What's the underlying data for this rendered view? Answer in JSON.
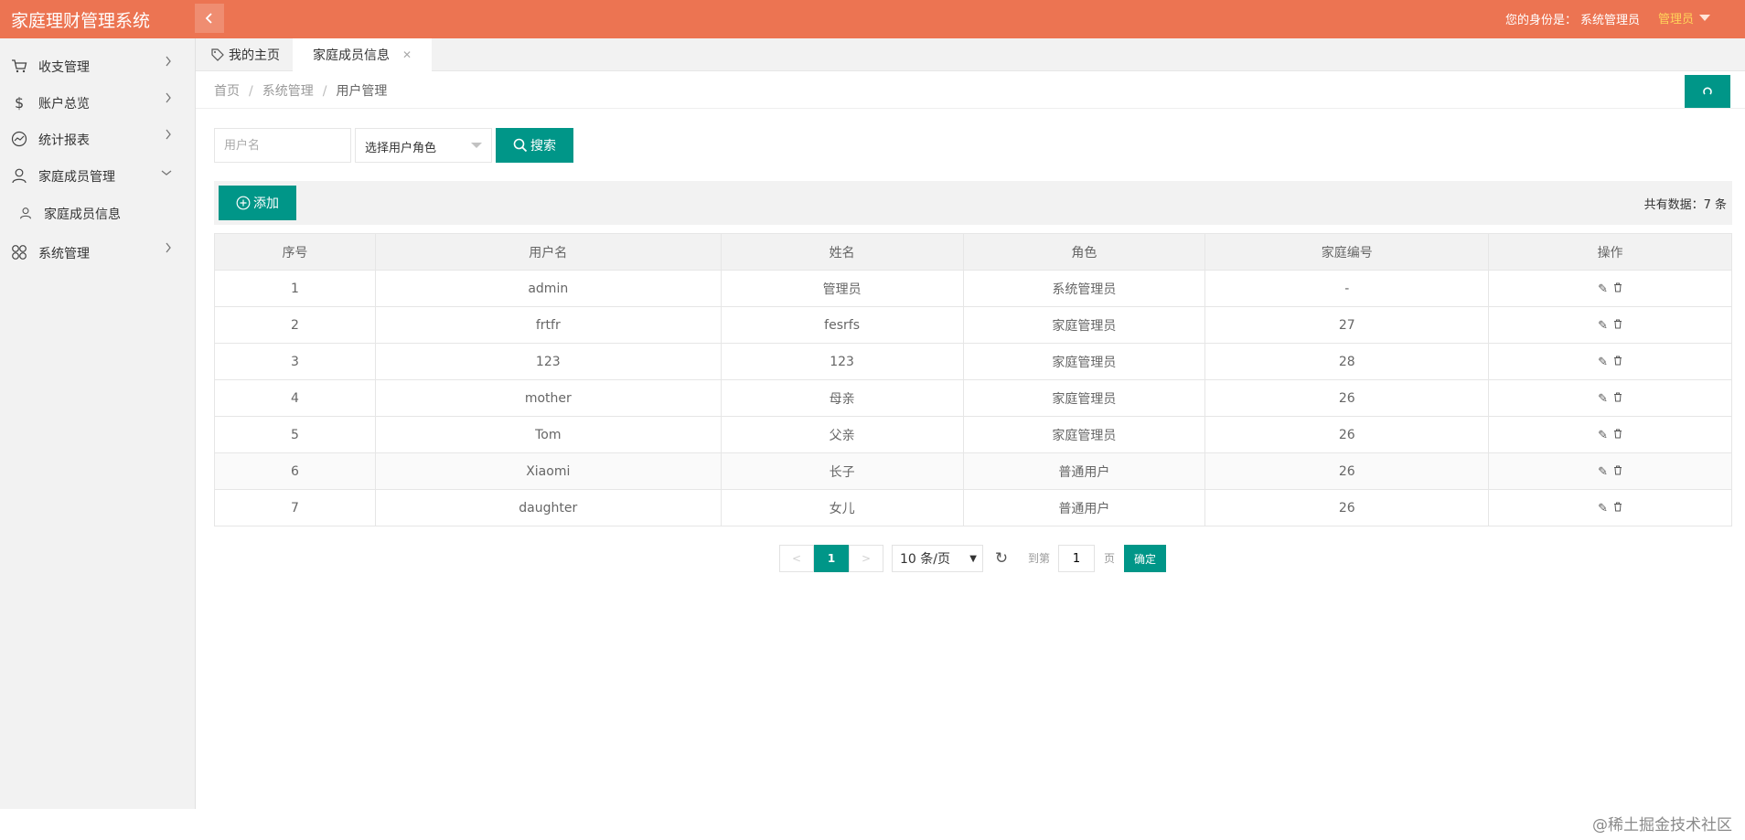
{
  "app": {
    "title": "家庭理财管理系统"
  },
  "header": {
    "identity_label": "您的身份是：",
    "identity_role": "系统管理员",
    "user_menu": "管理员"
  },
  "sidebar": {
    "items": [
      {
        "label": "收支管理",
        "icon": "cart-icon"
      },
      {
        "label": "账户总览",
        "icon": "dollar-icon"
      },
      {
        "label": "统计报表",
        "icon": "chart-icon"
      },
      {
        "label": "家庭成员管理",
        "icon": "user-icon"
      },
      {
        "label": "家庭成员信息",
        "icon": "user-icon"
      },
      {
        "label": "系统管理",
        "icon": "grid-icon"
      }
    ]
  },
  "tabs": {
    "home": "我的主页",
    "active": "家庭成员信息"
  },
  "breadcrumb": {
    "home": "首页",
    "section": "系统管理",
    "current": "用户管理",
    "separator": "/"
  },
  "search": {
    "username_placeholder": "用户名",
    "role_placeholder": "选择用户角色",
    "button": "搜索"
  },
  "toolbar": {
    "add": "添加",
    "total": "共有数据：7 条"
  },
  "table": {
    "headers": [
      "序号",
      "用户名",
      "姓名",
      "角色",
      "家庭编号",
      "操作"
    ],
    "rows": [
      [
        "1",
        "admin",
        "管理员",
        "系统管理员",
        "-"
      ],
      [
        "2",
        "frtfr",
        "fesrfs",
        "家庭管理员",
        "27"
      ],
      [
        "3",
        "123",
        "123",
        "家庭管理员",
        "28"
      ],
      [
        "4",
        "mother",
        "母亲",
        "家庭管理员",
        "26"
      ],
      [
        "5",
        "Tom",
        "父亲",
        "家庭管理员",
        "26"
      ],
      [
        "6",
        "Xiaomi",
        "长子",
        "普通用户",
        "26"
      ],
      [
        "7",
        "daughter",
        "女儿",
        "普通用户",
        "26"
      ]
    ]
  },
  "pagination": {
    "prev": "<",
    "current": "1",
    "next": ">",
    "page_size": "10 条/页",
    "goto_label": "到第",
    "goto_value": "1",
    "page_unit": "页",
    "confirm": "确定"
  },
  "footer": {
    "watermark": "@稀土掘金技术社区"
  },
  "colors": {
    "header": "#ec7452",
    "primary": "#009688",
    "user_menu": "#ffd35a"
  }
}
